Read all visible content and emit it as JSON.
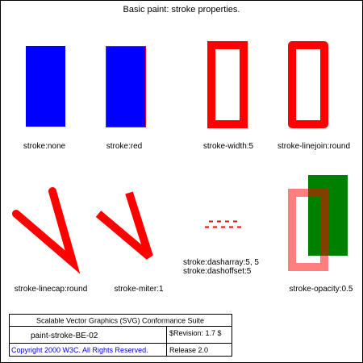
{
  "page": {
    "title": "Basic paint: stroke properties."
  },
  "tests": [
    {
      "label": "stroke:none"
    },
    {
      "label": "stroke:red"
    },
    {
      "label": "stroke-width:5"
    },
    {
      "label": "stroke-linejoin:round"
    },
    {
      "label": "stroke-linecap:round"
    },
    {
      "label": "stroke-miter:1"
    },
    {
      "label_line1": "stroke:dasharray:5, 5",
      "label_line2": "stroke:dashoffset:5"
    },
    {
      "label": "stroke-opacity:0.5"
    }
  ],
  "footer": {
    "suite": "Scalable Vector Graphics (SVG) Conformance Suite",
    "test_name": "paint-stroke-BE-02",
    "revision": "$Revision: 1.7 $",
    "copyright": "Copyright 2000 W3C. All Rights Reserved.",
    "release": "Release 2.0"
  },
  "colors": {
    "blue": "#0000ff",
    "red": "#ff0000",
    "green": "#008000",
    "copyright_link": "#0000cc"
  }
}
